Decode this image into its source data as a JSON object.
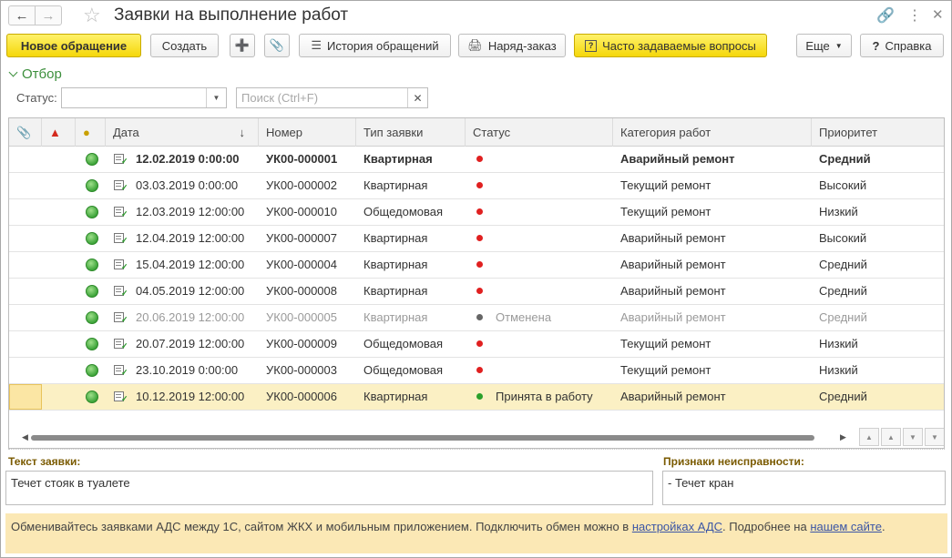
{
  "window": {
    "title": "Заявки на выполнение работ"
  },
  "toolbar": {
    "new_request": "Новое обращение",
    "create": "Создать",
    "history": "История обращений",
    "work_order": "Наряд-заказ",
    "faq": "Часто задаваемые вопросы",
    "more": "Еще",
    "help": "Справка"
  },
  "filter": {
    "title": "Отбор",
    "status_label": "Статус:",
    "status_value": "",
    "search_placeholder": "Поиск (Ctrl+F)"
  },
  "table": {
    "columns": [
      "Дата",
      "Номер",
      "Тип заявки",
      "Статус",
      "Категория работ",
      "Приоритет"
    ],
    "rows": [
      {
        "date": "12.02.2019 0:00:00",
        "number": "УК00-000001",
        "type": "Квартирная",
        "status": "",
        "status_color": "#e02020",
        "category": "Аварийный ремонт",
        "priority": "Средний",
        "style": "bold"
      },
      {
        "date": "03.03.2019 0:00:00",
        "number": "УК00-000002",
        "type": "Квартирная",
        "status": "",
        "status_color": "#e02020",
        "category": "Текущий ремонт",
        "priority": "Высокий",
        "style": ""
      },
      {
        "date": "12.03.2019 12:00:00",
        "number": "УК00-000010",
        "type": "Общедомовая",
        "status": "",
        "status_color": "#e02020",
        "category": "Текущий ремонт",
        "priority": "Низкий",
        "style": ""
      },
      {
        "date": "12.04.2019 12:00:00",
        "number": "УК00-000007",
        "type": "Квартирная",
        "status": "",
        "status_color": "#e02020",
        "category": "Аварийный ремонт",
        "priority": "Высокий",
        "style": ""
      },
      {
        "date": "15.04.2019 12:00:00",
        "number": "УК00-000004",
        "type": "Квартирная",
        "status": "",
        "status_color": "#e02020",
        "category": "Аварийный ремонт",
        "priority": "Средний",
        "style": ""
      },
      {
        "date": "04.05.2019 12:00:00",
        "number": "УК00-000008",
        "type": "Квартирная",
        "status": "",
        "status_color": "#e02020",
        "category": "Аварийный ремонт",
        "priority": "Средний",
        "style": ""
      },
      {
        "date": "20.06.2019 12:00:00",
        "number": "УК00-000005",
        "type": "Квартирная",
        "status": "Отменена",
        "status_color": "#666666",
        "category": "Аварийный ремонт",
        "priority": "Средний",
        "style": "muted"
      },
      {
        "date": "20.07.2019 12:00:00",
        "number": "УК00-000009",
        "type": "Общедомовая",
        "status": "",
        "status_color": "#e02020",
        "category": "Текущий ремонт",
        "priority": "Низкий",
        "style": ""
      },
      {
        "date": "23.10.2019 0:00:00",
        "number": "УК00-000003",
        "type": "Общедомовая",
        "status": "",
        "status_color": "#e02020",
        "category": "Текущий ремонт",
        "priority": "Низкий",
        "style": ""
      },
      {
        "date": "10.12.2019 12:00:00",
        "number": "УК00-000006",
        "type": "Квартирная",
        "status": "Принята в работу",
        "status_color": "#2aa02a",
        "category": "Аварийный ремонт",
        "priority": "Средний",
        "style": "selected"
      }
    ]
  },
  "details": {
    "text_label": "Текст заявки:",
    "text_value": "Течет стояк в туалете",
    "signs_label": "Признаки неисправности:",
    "signs_value": "- Течет кран"
  },
  "info": {
    "text1": "Обменивайтесь заявками АДС между 1С, сайтом ЖКХ и мобильным приложением. Подключить обмен можно в ",
    "link1": "настройках АДС",
    "text2": ". Подробнее на ",
    "link2": "нашем сайте",
    "text3": "."
  },
  "colors": {
    "accent_yellow": "#f5d70a",
    "green": "#3c8f3c",
    "selected_row": "#fbf0c4",
    "info_bg": "#fbe8b5"
  }
}
